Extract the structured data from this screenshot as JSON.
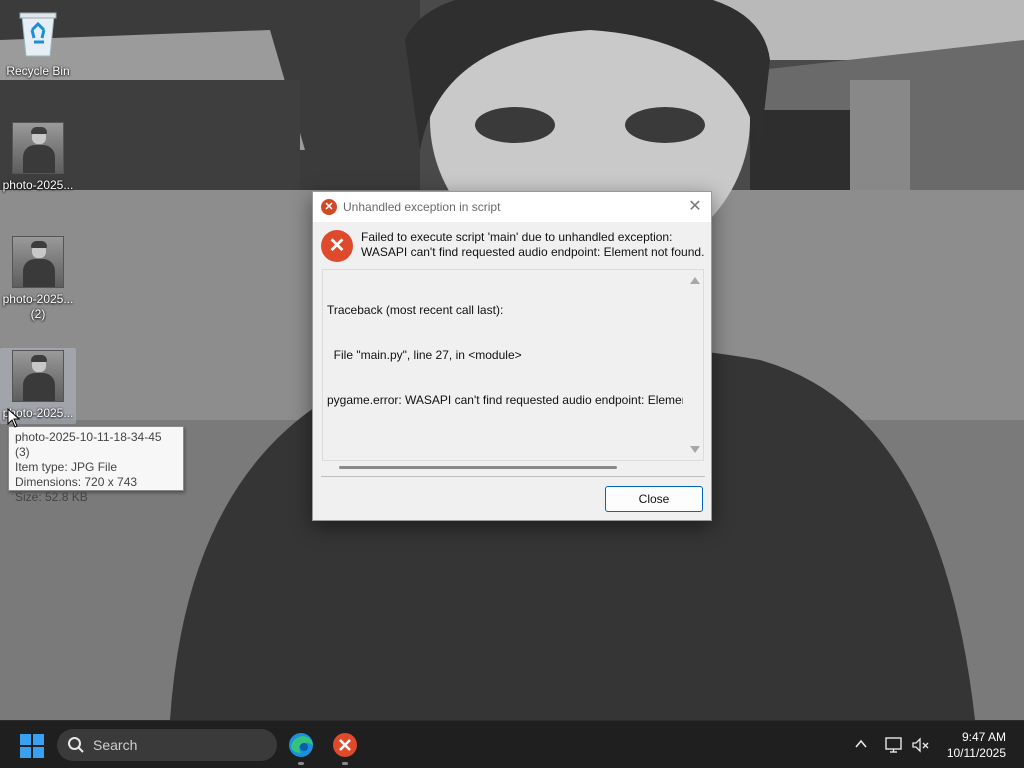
{
  "desktop": {
    "icons": [
      {
        "label": "Recycle Bin"
      },
      {
        "label": "photo-2025..."
      },
      {
        "label": "photo-2025...",
        "label_line2": "(2)"
      },
      {
        "label": "photo-2025..."
      }
    ],
    "tooltip": {
      "line1": "photo-2025-10-11-18-34-45 (3)",
      "line2": "Item type: JPG File",
      "line3": "Dimensions: 720 x 743",
      "line4": "Size: 52.8 KB"
    }
  },
  "dialog": {
    "title": "Unhandled exception in script",
    "message_line1": "Failed to execute script 'main' due to unhandled exception:",
    "message_line2": "WASAPI can't find requested audio endpoint: Element not found.",
    "traceback": [
      "Traceback (most recent call last):",
      "  File \"main.py\", line 27, in <module>",
      "pygame.error: WASAPI can't find requested audio endpoint: Element not found."
    ],
    "close_button": "Close",
    "title_close_glyph": "✕",
    "error_glyph": "✕"
  },
  "taskbar": {
    "search_placeholder": "Search",
    "time": "9:47 AM",
    "date": "10/11/2025",
    "apps": [
      {
        "icon": "edge-icon"
      },
      {
        "icon": "python-error-app-icon"
      }
    ]
  },
  "colors": {
    "accent": "#0067c0",
    "error": "#e04a2c",
    "taskbar": "#1f1f1f"
  }
}
